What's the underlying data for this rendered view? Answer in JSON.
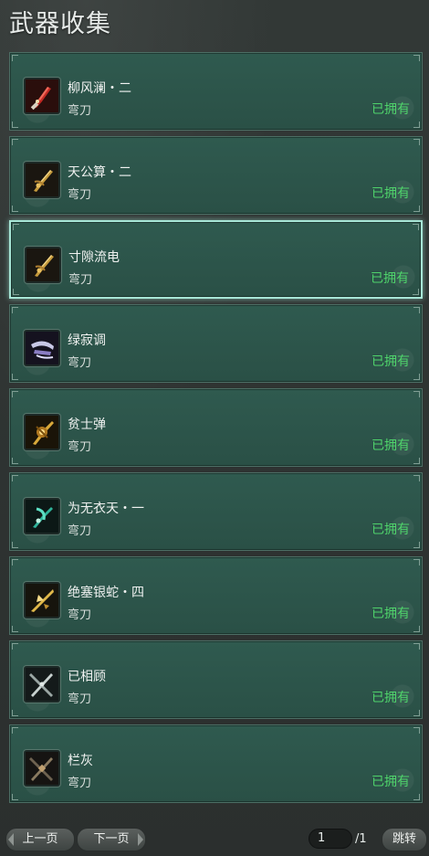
{
  "header": {
    "title": "武器收集"
  },
  "weapons": [
    {
      "name": "柳风澜・二",
      "type": "弯刀",
      "status": "已拥有",
      "icon": "red-curved-blade-icon"
    },
    {
      "name": "天公算・二",
      "type": "弯刀",
      "status": "已拥有",
      "icon": "golden-blade-icon"
    },
    {
      "name": "寸隙流电",
      "type": "弯刀",
      "status": "已拥有",
      "icon": "golden-blade-icon"
    },
    {
      "name": "绿寂调",
      "type": "弯刀",
      "status": "已拥有",
      "icon": "silver-purple-blade-icon"
    },
    {
      "name": "贫士弹",
      "type": "弯刀",
      "status": "已拥有",
      "icon": "ornate-gold-blade-icon"
    },
    {
      "name": "为无衣天・一",
      "type": "弯刀",
      "status": "已拥有",
      "icon": "teal-blade-icon"
    },
    {
      "name": "绝塞银蛇・四",
      "type": "弯刀",
      "status": "已拥有",
      "icon": "gold-winged-blade-icon"
    },
    {
      "name": "已相顾",
      "type": "弯刀",
      "status": "已拥有",
      "icon": "crossed-daggers-icon"
    },
    {
      "name": "栏灰",
      "type": "弯刀",
      "status": "已拥有",
      "icon": "crossed-dark-daggers-icon"
    }
  ],
  "selected_index": 2,
  "pagination": {
    "prev_label": "上一页",
    "next_label": "下一页",
    "current_page": "1",
    "total_pages": "/1",
    "jump_label": "跳转"
  },
  "colors": {
    "status_owned": "#4fd36b",
    "card_bg": "#2f5a4f",
    "selected_border": "#a7e6d6"
  }
}
